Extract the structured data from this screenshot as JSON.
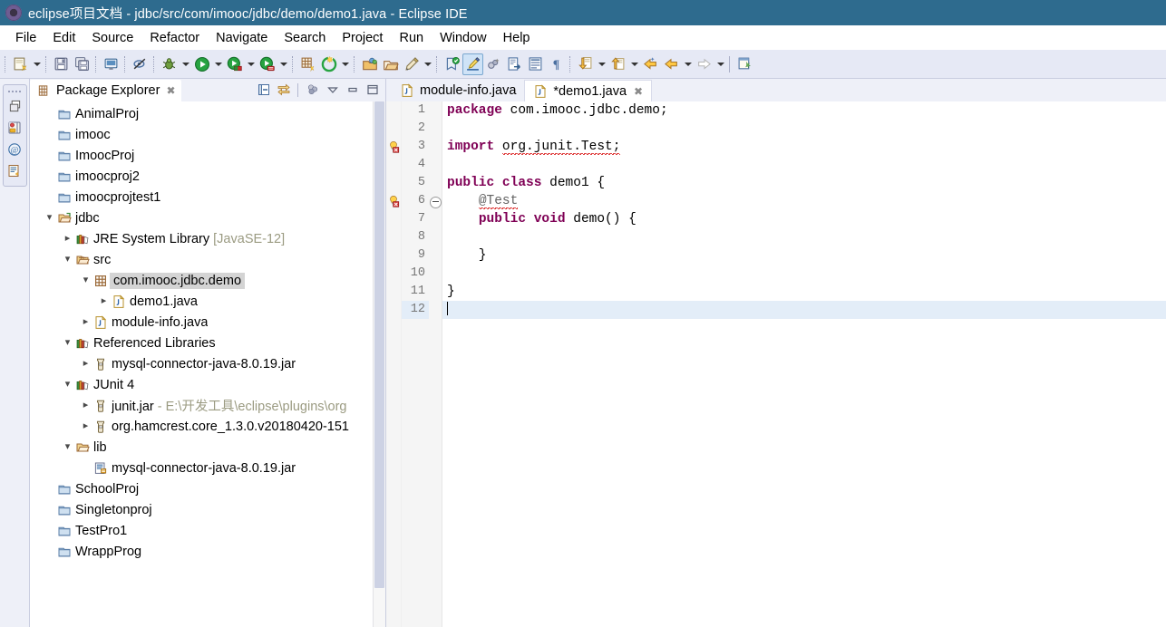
{
  "window": {
    "title": "eclipse项目文档 - jdbc/src/com/imooc/jdbc/demo/demo1.java - Eclipse IDE",
    "logo_icon": "eclipse-logo-icon"
  },
  "menubar": {
    "items": [
      "File",
      "Edit",
      "Source",
      "Refactor",
      "Navigate",
      "Search",
      "Project",
      "Run",
      "Window",
      "Help"
    ]
  },
  "toolbar": {
    "groups": [
      {
        "buttons": [
          {
            "name": "new-wizard-button",
            "icon": "new-file-icon",
            "dropdown": true
          }
        ]
      },
      {
        "buttons": [
          {
            "name": "save-button",
            "icon": "save-icon",
            "dropdown": false
          },
          {
            "name": "save-all-button",
            "icon": "save-all-icon",
            "dropdown": false
          }
        ]
      },
      {
        "buttons": [
          {
            "name": "print-button",
            "icon": "print-icon",
            "dropdown": false
          }
        ]
      },
      {
        "buttons": [
          {
            "name": "toggle-mark-occurrences-button",
            "icon": "mark-occurrences-icon",
            "dropdown": false
          }
        ]
      },
      {
        "buttons": [
          {
            "name": "debug-button",
            "icon": "debug-bug-icon",
            "dropdown": true
          },
          {
            "name": "run-button",
            "icon": "run-play-icon",
            "dropdown": true
          },
          {
            "name": "coverage-button",
            "icon": "run-coverage-icon",
            "dropdown": true
          },
          {
            "name": "profile-button",
            "icon": "run-profile-icon",
            "dropdown": true
          }
        ]
      },
      {
        "buttons": [
          {
            "name": "new-java-package-button",
            "icon": "new-package-icon",
            "dropdown": false
          },
          {
            "name": "external-tools-button",
            "icon": "external-tools-icon",
            "dropdown": true
          }
        ]
      },
      {
        "buttons": [
          {
            "name": "new-java-project-button",
            "icon": "java-project-icon",
            "dropdown": false
          },
          {
            "name": "open-type-button",
            "icon": "open-folder-icon",
            "dropdown": false
          },
          {
            "name": "new-class-button",
            "icon": "pencil-icon",
            "dropdown": true
          }
        ]
      },
      {
        "buttons": [
          {
            "name": "search-button",
            "icon": "search-type-icon",
            "dropdown": false
          },
          {
            "name": "highlight-button",
            "icon": "highlight-brush-icon",
            "dropdown": false,
            "active": true
          },
          {
            "name": "last-edit-location-button",
            "icon": "last-edit-icon",
            "dropdown": false
          },
          {
            "name": "open-task-button",
            "icon": "open-task-icon",
            "dropdown": false
          },
          {
            "name": "show-whitespace-button",
            "icon": "whitespace-icon",
            "dropdown": false
          },
          {
            "name": "paragraph-marks-button",
            "icon": "pilcrow-icon",
            "dropdown": false
          }
        ]
      },
      {
        "buttons": [
          {
            "name": "next-annotation-button",
            "icon": "next-annotation-icon",
            "dropdown": true
          },
          {
            "name": "previous-annotation-button",
            "icon": "previous-annotation-icon",
            "dropdown": true
          },
          {
            "name": "back-history-button",
            "icon": "back-arrow-icon",
            "dropdown": false
          },
          {
            "name": "back-button",
            "icon": "back-arrow-icon",
            "dropdown": true
          },
          {
            "name": "forward-button",
            "icon": "forward-arrow-icon",
            "dropdown": true
          }
        ]
      },
      {
        "buttons": [
          {
            "name": "new-window-button",
            "icon": "new-window-icon",
            "dropdown": false
          }
        ]
      }
    ]
  },
  "fastbar": {
    "buttons": [
      {
        "name": "restore-view-button",
        "icon": "restore-window-icon"
      },
      {
        "name": "package-explorer-fastview-button",
        "icon": "package-explorer-icon"
      },
      {
        "name": "at-sign-fastview-button",
        "icon": "at-sign-icon"
      },
      {
        "name": "outline-fastview-button",
        "icon": "outline-view-icon"
      }
    ]
  },
  "explorer": {
    "tab_title": "Package Explorer",
    "tab_icon": "package-explorer-icon",
    "close_icon": "close-icon",
    "tools": [
      {
        "name": "collapse-all-button",
        "icon": "collapse-all-icon"
      },
      {
        "name": "link-with-editor-button",
        "icon": "link-with-editor-icon"
      },
      {
        "name": "view-menu-button",
        "icon": "view-menu-icon"
      },
      {
        "name": "filter-menu-button",
        "icon": "chevron-down-icon"
      },
      {
        "name": "minimize-view-button",
        "icon": "minimize-icon"
      },
      {
        "name": "maximize-view-button",
        "icon": "maximize-icon"
      }
    ],
    "tree": [
      {
        "label": "AnimalProj",
        "indent": 0,
        "twisty": "none",
        "icon": "project-closed-icon"
      },
      {
        "label": "imooc",
        "indent": 0,
        "twisty": "none",
        "icon": "project-closed-icon"
      },
      {
        "label": "ImoocProj",
        "indent": 0,
        "twisty": "none",
        "icon": "project-closed-icon"
      },
      {
        "label": "imoocproj2",
        "indent": 0,
        "twisty": "none",
        "icon": "project-closed-icon"
      },
      {
        "label": "imoocprojtest1",
        "indent": 0,
        "twisty": "none",
        "icon": "project-closed-icon"
      },
      {
        "label": "jdbc",
        "indent": 0,
        "twisty": "expanded",
        "icon": "project-open-icon"
      },
      {
        "label": "JRE System Library",
        "indent": 1,
        "twisty": "collapsed",
        "icon": "library-icon",
        "suffix": "[JavaSE-12]"
      },
      {
        "label": "src",
        "indent": 1,
        "twisty": "expanded",
        "icon": "source-folder-icon"
      },
      {
        "label": "com.imooc.jdbc.demo",
        "indent": 2,
        "twisty": "expanded",
        "icon": "package-icon",
        "selected": true
      },
      {
        "label": "demo1.java",
        "indent": 3,
        "twisty": "collapsed",
        "icon": "java-file-icon"
      },
      {
        "label": "module-info.java",
        "indent": 2,
        "twisty": "collapsed",
        "icon": "java-file-icon"
      },
      {
        "label": "Referenced Libraries",
        "indent": 1,
        "twisty": "expanded",
        "icon": "library-icon"
      },
      {
        "label": "mysql-connector-java-8.0.19.jar",
        "indent": 2,
        "twisty": "collapsed",
        "icon": "jar-icon"
      },
      {
        "label": "JUnit 4",
        "indent": 1,
        "twisty": "expanded",
        "icon": "library-icon"
      },
      {
        "label": "junit.jar",
        "indent": 2,
        "twisty": "collapsed",
        "icon": "jar-icon",
        "suffix": "- E:\\开发工具\\eclipse\\plugins\\org"
      },
      {
        "label": "org.hamcrest.core_1.3.0.v20180420-151",
        "indent": 2,
        "twisty": "collapsed",
        "icon": "jar-icon"
      },
      {
        "label": "lib",
        "indent": 1,
        "twisty": "expanded",
        "icon": "folder-open-icon"
      },
      {
        "label": "mysql-connector-java-8.0.19.jar",
        "indent": 2,
        "twisty": "none",
        "icon": "jar-file-icon"
      },
      {
        "label": "SchoolProj",
        "indent": 0,
        "twisty": "none",
        "icon": "project-closed-icon"
      },
      {
        "label": "Singletonproj",
        "indent": 0,
        "twisty": "none",
        "icon": "project-closed-icon"
      },
      {
        "label": "TestPro1",
        "indent": 0,
        "twisty": "none",
        "icon": "project-closed-icon"
      },
      {
        "label": "WrappProg",
        "indent": 0,
        "twisty": "none",
        "icon": "project-closed-icon"
      }
    ]
  },
  "editor": {
    "tabs": [
      {
        "label": "module-info.java",
        "icon": "java-file-icon",
        "active": false,
        "closable": false
      },
      {
        "label": "*demo1.java",
        "icon": "java-file-icon",
        "active": true,
        "closable": true
      }
    ],
    "close_icon": "close-icon",
    "lines": [
      {
        "n": "1",
        "segments": [
          {
            "t": "package",
            "c": "kw"
          },
          {
            "t": " com.imooc.jdbc.demo;",
            "c": ""
          }
        ]
      },
      {
        "n": "2",
        "segments": []
      },
      {
        "n": "3",
        "segments": [
          {
            "t": "import",
            "c": "kw"
          },
          {
            "t": " ",
            "c": ""
          },
          {
            "t": "org.junit.Test;",
            "c": "squiggle"
          }
        ],
        "marker": "error-quickfix-icon"
      },
      {
        "n": "4",
        "segments": []
      },
      {
        "n": "5",
        "segments": [
          {
            "t": "public",
            "c": "kw"
          },
          {
            "t": " ",
            "c": ""
          },
          {
            "t": "class",
            "c": "kw"
          },
          {
            "t": " demo1 {",
            "c": ""
          }
        ]
      },
      {
        "n": "6",
        "segments": [
          {
            "t": "    ",
            "c": ""
          },
          {
            "t": "@Test",
            "c": "ann squiggle"
          }
        ],
        "marker": "error-quickfix-icon",
        "fold": true
      },
      {
        "n": "7",
        "segments": [
          {
            "t": "    ",
            "c": ""
          },
          {
            "t": "public",
            "c": "kw"
          },
          {
            "t": " ",
            "c": ""
          },
          {
            "t": "void",
            "c": "kw"
          },
          {
            "t": " demo() {",
            "c": ""
          }
        ]
      },
      {
        "n": "8",
        "segments": []
      },
      {
        "n": "9",
        "segments": [
          {
            "t": "    }",
            "c": ""
          }
        ]
      },
      {
        "n": "10",
        "segments": []
      },
      {
        "n": "11",
        "segments": [
          {
            "t": "}",
            "c": ""
          }
        ]
      },
      {
        "n": "12",
        "segments": [],
        "current": true,
        "caret": true
      }
    ]
  },
  "colors": {
    "title_bar": "#2e6b8e",
    "toolbar_bg": "#e6e9f5",
    "keyword": "#7f0055",
    "annotation": "#646464",
    "error_squiggle": "#d40000",
    "current_line": "#e3edf8",
    "selection": "#d4d4d4"
  }
}
